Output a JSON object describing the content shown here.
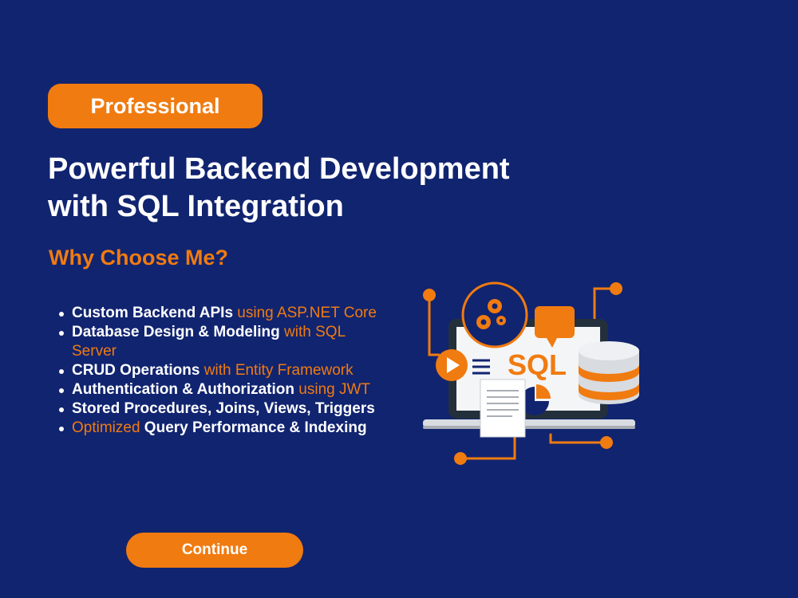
{
  "badge": {
    "label": "Professional"
  },
  "headline": {
    "line1": "Powerful Backend Development",
    "line2": "with SQL Integration"
  },
  "why": {
    "label": "Why Choose Me?"
  },
  "features": [
    {
      "a": "Custom Backend APIs",
      "b": " using ASP.NET Core"
    },
    {
      "a": "Database Design & Modeling",
      "b": " with SQL Server"
    },
    {
      "a": "CRUD Operations",
      "b": " with Entity Framework"
    },
    {
      "a": "Authentication & Authorization",
      "b": " using JWT"
    },
    {
      "a": "Stored Procedures, Joins, Views, Triggers",
      "b": ""
    },
    {
      "pre": "Optimized",
      "a": " Query Performance & Indexing"
    }
  ],
  "illustration": {
    "label": "SQL",
    "icon": "laptop-sql-database-illustration"
  },
  "continue": {
    "label": "Continue"
  },
  "colors": {
    "background": "#112470",
    "accent": "#f07b10",
    "text": "#ffffff"
  }
}
